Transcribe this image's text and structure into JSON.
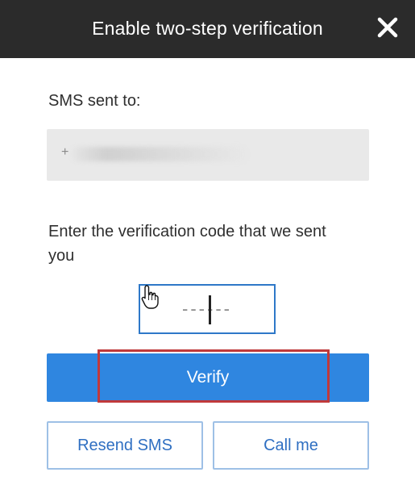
{
  "dialog": {
    "title": "Enable two-step verification",
    "close_icon": "close-icon"
  },
  "sms": {
    "label": "SMS sent to:",
    "phone_value": "+"
  },
  "code": {
    "label": "Enter the verification code that we sent you",
    "placeholder": "------",
    "value": ""
  },
  "buttons": {
    "verify": "Verify",
    "resend": "Resend SMS",
    "call_me": "Call me"
  },
  "colors": {
    "header_bg": "#2b2b2b",
    "primary": "#2f86e0",
    "outline_text": "#2f6fc2",
    "highlight": "#c0393b"
  }
}
